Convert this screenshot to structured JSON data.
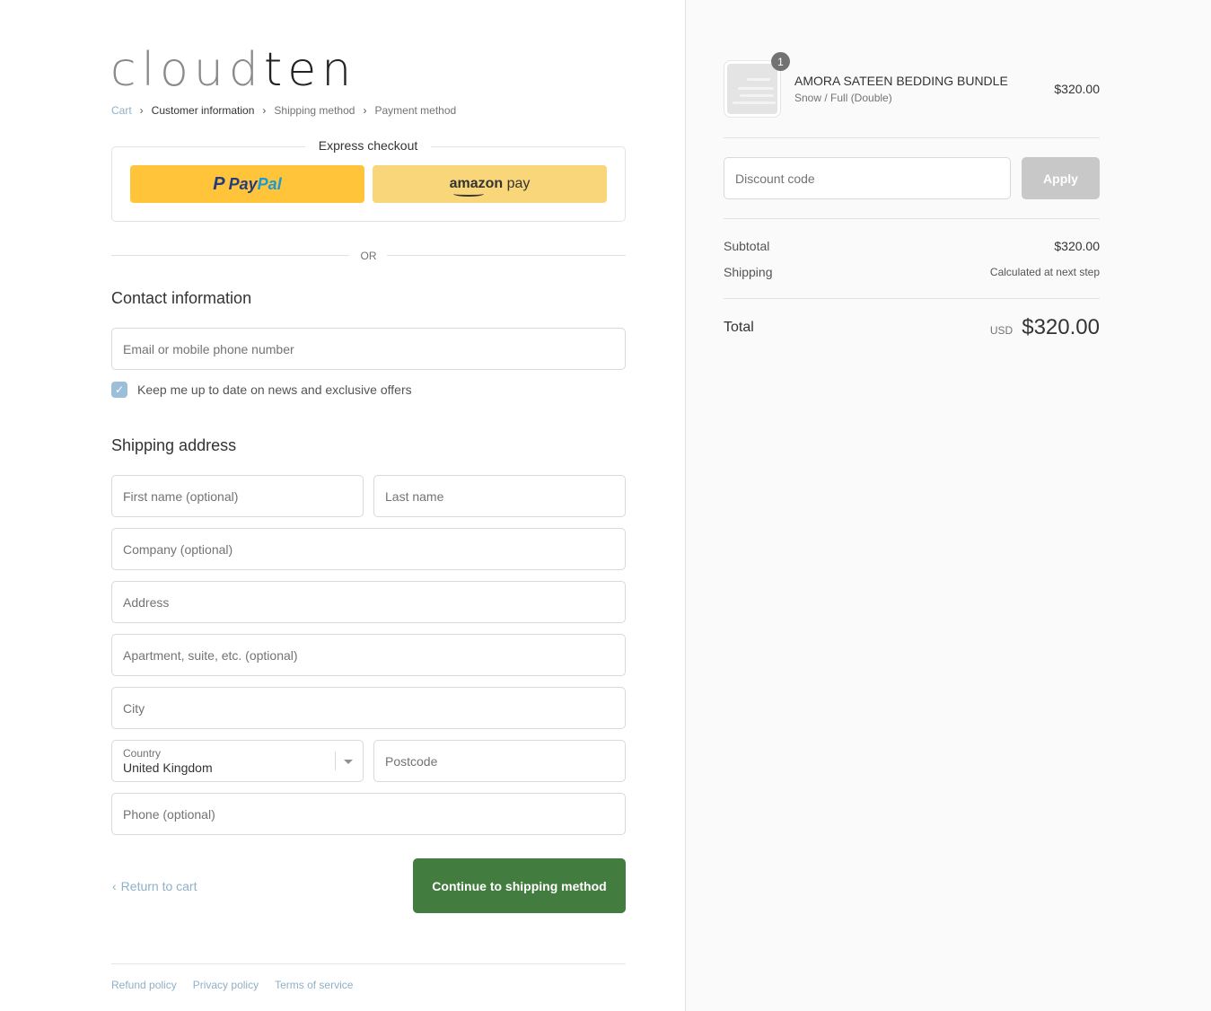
{
  "brand": {
    "logo_light": "cloud",
    "logo_dark": "ten"
  },
  "breadcrumb": {
    "items": [
      {
        "label": "Cart",
        "state": "link"
      },
      {
        "label": "Customer information",
        "state": "current"
      },
      {
        "label": "Shipping method",
        "state": "upcoming"
      },
      {
        "label": "Payment method",
        "state": "upcoming"
      }
    ],
    "separator": "›"
  },
  "express_checkout": {
    "title": "Express checkout",
    "paypal": {
      "p": "P",
      "pay": "Pay",
      "pal": "Pal"
    },
    "amazon": {
      "amazon": "amazon",
      "pay": " pay"
    },
    "or_label": "OR"
  },
  "contact": {
    "title": "Contact information",
    "email_placeholder": "Email or mobile phone number",
    "newsletter_label": "Keep me up to date on news and exclusive offers",
    "newsletter_checked": true,
    "checkmark": "✓"
  },
  "shipping": {
    "title": "Shipping address",
    "first_name_placeholder": "First name (optional)",
    "last_name_placeholder": "Last name",
    "company_placeholder": "Company (optional)",
    "address_placeholder": "Address",
    "apartment_placeholder": "Apartment, suite, etc. (optional)",
    "city_placeholder": "City",
    "country_label": "Country",
    "country_value": "United Kingdom",
    "postcode_placeholder": "Postcode",
    "phone_placeholder": "Phone (optional)"
  },
  "actions": {
    "return_chevron": "‹",
    "return_label": "Return to cart",
    "continue_label": "Continue to shipping method"
  },
  "footer": {
    "links": [
      "Refund policy",
      "Privacy policy",
      "Terms of service"
    ]
  },
  "order": {
    "product": {
      "name": "AMORA SATEEN BEDDING BUNDLE",
      "variant": "Snow / Full (Double)",
      "price": "$320.00",
      "quantity": "1"
    },
    "discount_placeholder": "Discount code",
    "apply_label": "Apply",
    "subtotal_label": "Subtotal",
    "subtotal_value": "$320.00",
    "shipping_label": "Shipping",
    "shipping_value": "Calculated at next step",
    "total_label": "Total",
    "total_currency": "USD",
    "total_value": "$320.00"
  },
  "colors": {
    "accent_button": "#437c3f",
    "link": "#8fb0c6",
    "paypal_bg": "#ffc439",
    "amazon_bg": "#f9d67a",
    "apply_disabled": "#c8c8c8"
  }
}
